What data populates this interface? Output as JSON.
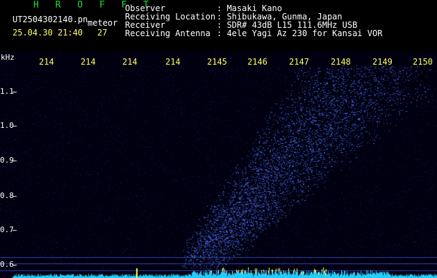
{
  "header": {
    "title": "H R O F F T",
    "filename": "UT2504302140.pn",
    "meteor_label": "meteor",
    "datetime": "25.04.30 21:40",
    "meteor_count": "27",
    "labels": {
      "observer": "Observer",
      "location": "Receiving Location",
      "receiver": "Receiver",
      "antenna": "Receiving Antenna"
    },
    "values": {
      "observer": ": Masaki Kano",
      "location": ": Shibukawa, Gunma, Japan",
      "receiver": ": SDR# 43dB L15 111.6MHz USB",
      "antenna": ": 4ele Yagi Az 230 for Kansai VOR"
    }
  },
  "plot": {
    "unit_label": "kHz",
    "unit_label_left": "kHz",
    "x_ticks": [
      "214",
      "214",
      "214",
      "214",
      "2145",
      "2146",
      "2147",
      "2148",
      "2149",
      "2150"
    ],
    "y_ticks": [
      "1.1",
      "1.0",
      "0.9",
      "0.8",
      "0.7",
      "0.6"
    ],
    "colors": {
      "background": "#000010",
      "noise": "#1a1a66",
      "echo": "#6688ff",
      "grid": "#3344aa",
      "signal_bar": "#22ccff",
      "tick_text": "#ffff66"
    }
  }
}
